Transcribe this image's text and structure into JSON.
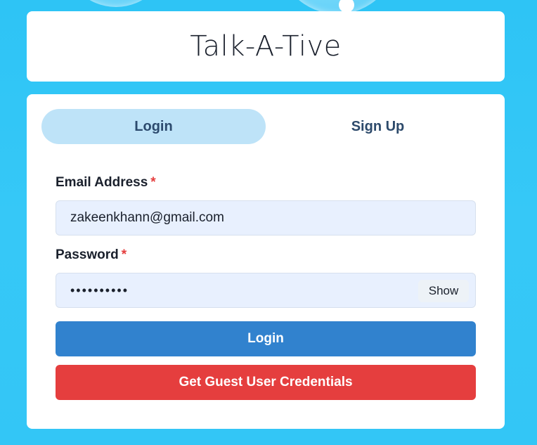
{
  "app": {
    "title": "Talk-A-Tive"
  },
  "tabs": [
    {
      "label": "Login",
      "active": true
    },
    {
      "label": "Sign Up",
      "active": false
    }
  ],
  "form": {
    "email": {
      "label": "Email Address",
      "required_mark": "*",
      "value": "zakeenkhann@gmail.com"
    },
    "password": {
      "label": "Password",
      "required_mark": "*",
      "value": "••••••••••",
      "show_label": "Show"
    },
    "login_button": "Login",
    "guest_button": "Get Guest User Credentials"
  },
  "colors": {
    "background": "#33c6f6",
    "tab_active": "#bee3f8",
    "input_bg": "#e8f0fe",
    "login_button": "#3182ce",
    "guest_button": "#e53e3e",
    "required": "#e53e3e"
  }
}
